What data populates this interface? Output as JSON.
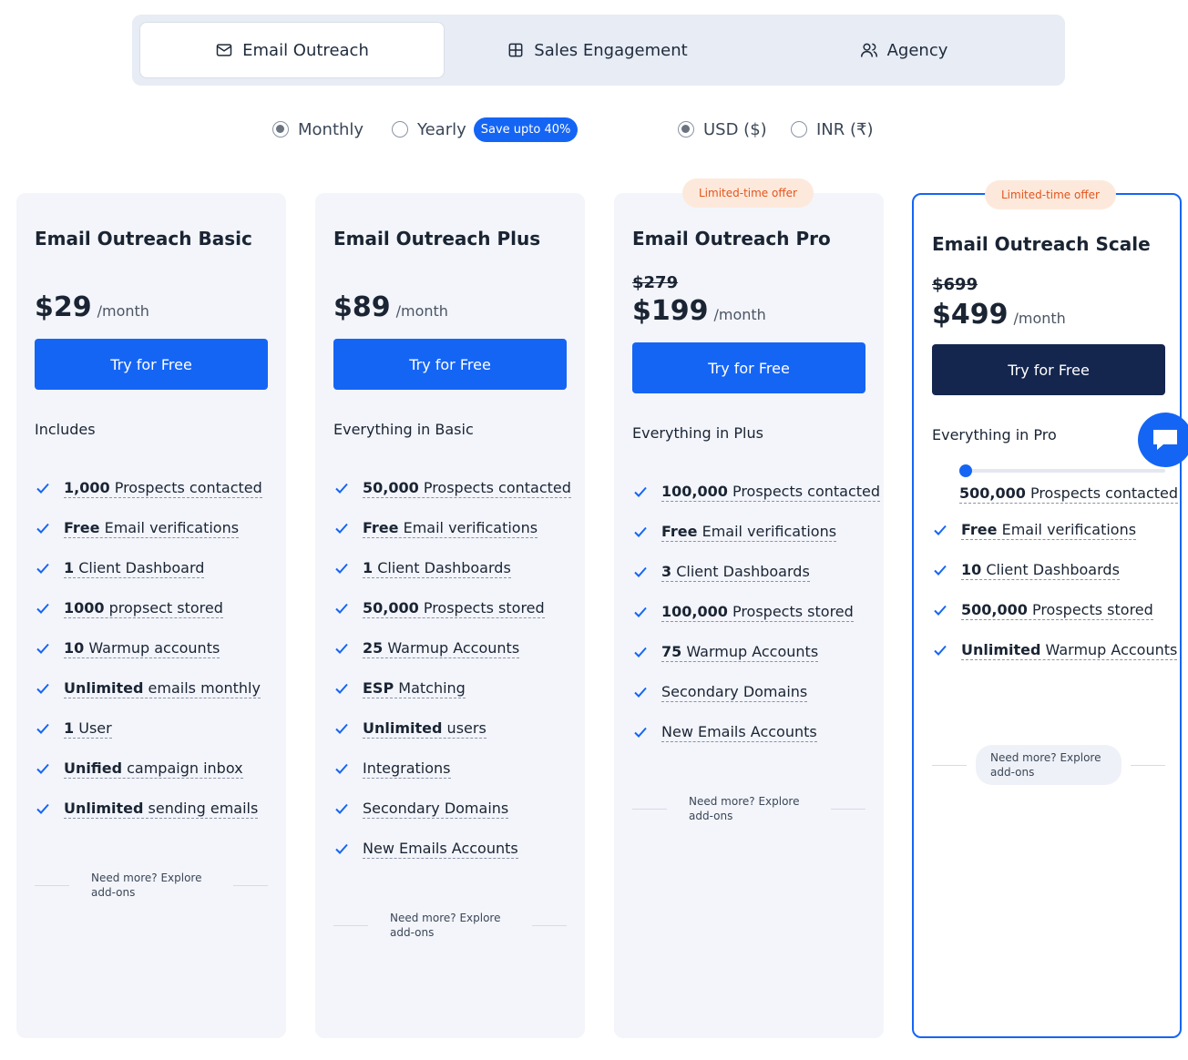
{
  "tabs": [
    {
      "label": "Email Outreach",
      "icon": "mail-icon"
    },
    {
      "label": "Sales Engagement",
      "icon": "grid-icon"
    },
    {
      "label": "Agency",
      "icon": "users-icon"
    }
  ],
  "billing": {
    "monthly": "Monthly",
    "yearly": "Yearly",
    "save_badge": "Save upto 40%"
  },
  "currency": {
    "usd": "USD ($)",
    "inr": "INR (₹)"
  },
  "colors": {
    "accent": "#1565f5",
    "dark_button": "#14264e",
    "offer_bg": "#fde9dc",
    "offer_text": "#e3541c"
  },
  "plans": [
    {
      "title": "Email Outreach Basic",
      "price": "$29",
      "period": "/month",
      "cta": "Try for Free",
      "includes": "Includes",
      "features": [
        {
          "b": "1,000",
          "t": " Prospects contacted"
        },
        {
          "b": "Free",
          "t": " Email verifications"
        },
        {
          "b": "1",
          "t": " Client Dashboard"
        },
        {
          "b": "1000",
          "t": " propsect stored"
        },
        {
          "b": "10",
          "t": " Warmup accounts"
        },
        {
          "b": "Unlimited",
          "t": " emails monthly"
        },
        {
          "b": "1",
          "t": " User"
        },
        {
          "b": "Unified",
          "t": " campaign inbox"
        },
        {
          "b": "Unlimited",
          "t": "  sending emails"
        }
      ],
      "more": "Need more? Explore add-ons"
    },
    {
      "title": "Email Outreach Plus",
      "price": "$89",
      "period": "/month",
      "cta": "Try for Free",
      "includes": "Everything in Basic",
      "features": [
        {
          "b": "50,000",
          "t": " Prospects contacted"
        },
        {
          "b": "Free",
          "t": " Email verifications"
        },
        {
          "b": "1",
          "t": "  Client Dashboards"
        },
        {
          "b": "50,000",
          "t": " Prospects stored"
        },
        {
          "b": "25",
          "t": " Warmup Accounts"
        },
        {
          "b": "ESP",
          "t": " Matching"
        },
        {
          "b": "Unlimited",
          "t": " users"
        },
        {
          "b": "",
          "t": "Integrations"
        },
        {
          "b": "",
          "t": "Secondary Domains"
        },
        {
          "b": "",
          "t": "New Emails Accounts"
        }
      ],
      "more": "Need more? Explore add-ons"
    },
    {
      "offer": "Limited-time offer",
      "title": "Email Outreach Pro",
      "old_price": "$279",
      "price": "$199",
      "period": "/month",
      "cta": "Try for Free",
      "includes": "Everything in Plus",
      "features": [
        {
          "b": "100,000",
          "t": " Prospects contacted"
        },
        {
          "b": "Free",
          "t": " Email verifications"
        },
        {
          "b": "3",
          "t": "  Client Dashboards"
        },
        {
          "b": "100,000",
          "t": " Prospects stored"
        },
        {
          "b": "75",
          "t": " Warmup Accounts"
        },
        {
          "b": "",
          "t": "Secondary Domains"
        },
        {
          "b": "",
          "t": "New Emails Accounts"
        }
      ],
      "more": "Need more? Explore add-ons"
    },
    {
      "offer": "Limited-time offer",
      "title": "Email Outreach Scale",
      "old_price": "$699",
      "price": "$499",
      "period": "/month",
      "cta": "Try for Free",
      "includes": "Everything in Pro",
      "slider_feature": {
        "b": "500,000",
        "t": " Prospects contacted"
      },
      "features": [
        {
          "b": "Free",
          "t": " Email verifications"
        },
        {
          "b": "10",
          "t": "  Client Dashboards"
        },
        {
          "b": "500,000",
          "t": " Prospects stored"
        },
        {
          "b": "Unlimited",
          "t": " Warmup Accounts"
        }
      ],
      "more": "Need more? Explore add-ons"
    }
  ],
  "chat": {
    "icon": "chat-icon"
  }
}
